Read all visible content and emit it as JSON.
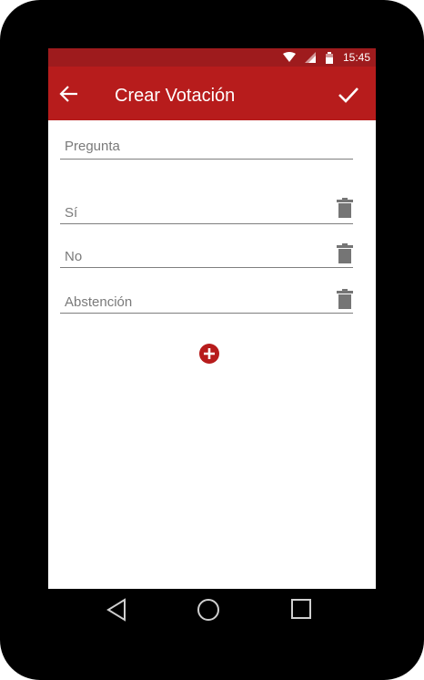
{
  "status_bar": {
    "time": "15:45",
    "icons": [
      "wifi-icon",
      "signal-icon",
      "battery-icon"
    ]
  },
  "app_bar": {
    "title": "Crear Votación",
    "back_icon": "arrow-back-icon",
    "confirm_icon": "checkmark-icon"
  },
  "form": {
    "question_placeholder": "Pregunta",
    "options": [
      {
        "placeholder": "Sí",
        "delete_icon": "trash-icon"
      },
      {
        "placeholder": "No",
        "delete_icon": "trash-icon"
      },
      {
        "placeholder": "Abstención",
        "delete_icon": "trash-icon"
      }
    ],
    "add_icon": "plus-circle-icon"
  },
  "nav_bar": {
    "icons": [
      "back-triangle-icon",
      "home-circle-icon",
      "recents-square-icon"
    ]
  },
  "colors": {
    "status_bar": "#9e1b1d",
    "app_bar": "#b71c1c",
    "accent": "#b71c1c",
    "device_frame": "#000000"
  }
}
